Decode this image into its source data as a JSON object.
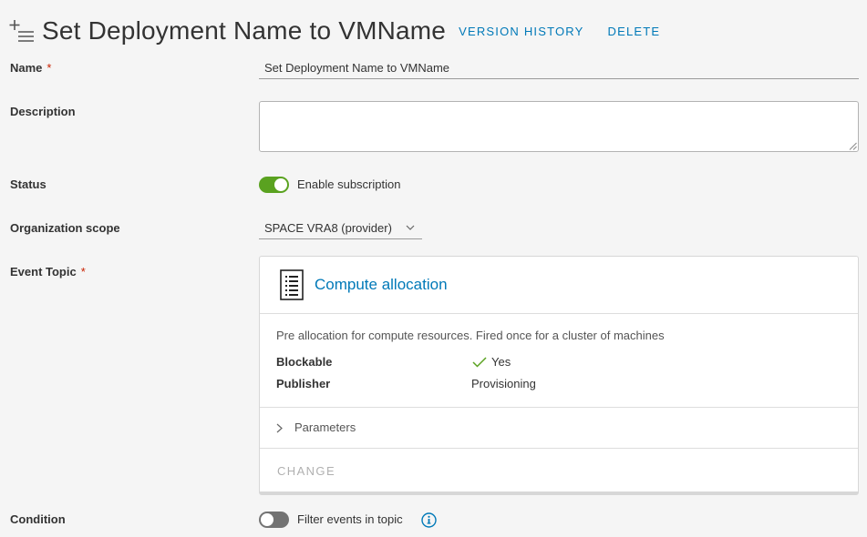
{
  "header": {
    "title": "Set Deployment Name to VMName",
    "version_history": "VERSION HISTORY",
    "delete": "DELETE"
  },
  "form": {
    "name": {
      "label": "Name",
      "required_mark": "*",
      "value": "Set Deployment Name to VMName"
    },
    "description": {
      "label": "Description",
      "value": ""
    },
    "status": {
      "label": "Status",
      "toggle_text": "Enable subscription",
      "enabled": true
    },
    "org_scope": {
      "label": "Organization scope",
      "selected": "SPACE VRA8 (provider)"
    },
    "event_topic": {
      "label": "Event Topic",
      "required_mark": "*",
      "card": {
        "title": "Compute allocation",
        "description": "Pre allocation for compute resources. Fired once for a cluster of machines",
        "properties": [
          {
            "key": "Blockable",
            "value": "Yes"
          },
          {
            "key": "Publisher",
            "value": "Provisioning"
          }
        ],
        "parameters_label": "Parameters",
        "change_label": "CHANGE"
      }
    },
    "condition": {
      "label": "Condition",
      "toggle_text": "Filter events in topic",
      "enabled": false
    }
  },
  "colors": {
    "accent": "#0079b8",
    "toggle_on": "#5aa220",
    "toggle_off": "#737373",
    "required": "#c92100"
  },
  "icons": [
    "add-list-icon",
    "document-list-icon",
    "check-icon",
    "chevron-down-icon",
    "chevron-right-icon",
    "info-icon"
  ]
}
